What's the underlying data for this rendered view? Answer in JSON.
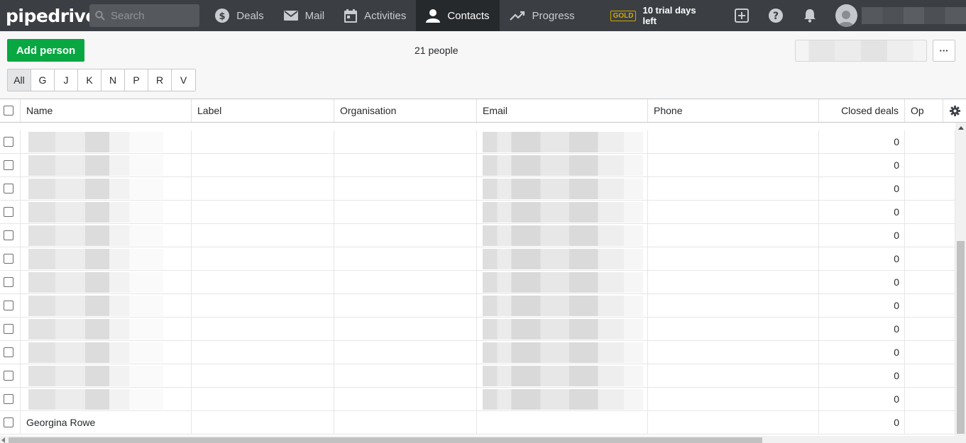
{
  "nav": {
    "logo": "pipedrive",
    "search_placeholder": "Search",
    "items": [
      {
        "label": "Deals",
        "icon": "dollar-circle-icon",
        "active": false
      },
      {
        "label": "Mail",
        "icon": "envelope-icon",
        "active": false
      },
      {
        "label": "Activities",
        "icon": "calendar-icon",
        "active": false
      },
      {
        "label": "Contacts",
        "icon": "person-icon",
        "active": true
      },
      {
        "label": "Progress",
        "icon": "trend-up-icon",
        "active": false
      }
    ],
    "plan_badge": "GOLD",
    "trial_text": "10 trial days left"
  },
  "toolbar": {
    "add_person_label": "Add person",
    "people_count": "21 people",
    "more_label": "···"
  },
  "alphabet": [
    "All",
    "G",
    "J",
    "K",
    "N",
    "P",
    "R",
    "V"
  ],
  "table": {
    "columns": [
      "Name",
      "Label",
      "Organisation",
      "Email",
      "Phone",
      "Closed deals",
      "Op"
    ],
    "rows": [
      {
        "name": "",
        "closed_deals": "0"
      },
      {
        "name": "",
        "closed_deals": "0"
      },
      {
        "name": "",
        "closed_deals": "0"
      },
      {
        "name": "",
        "closed_deals": "0"
      },
      {
        "name": "",
        "closed_deals": "0"
      },
      {
        "name": "",
        "closed_deals": "0"
      },
      {
        "name": "",
        "closed_deals": "0"
      },
      {
        "name": "",
        "closed_deals": "0"
      },
      {
        "name": "",
        "closed_deals": "0"
      },
      {
        "name": "",
        "closed_deals": "0"
      },
      {
        "name": "",
        "closed_deals": "0"
      },
      {
        "name": "",
        "closed_deals": "0"
      },
      {
        "name": "Georgina Rowe",
        "closed_deals": "0"
      }
    ]
  },
  "colors": {
    "topbar": "#3b3f44",
    "active_nav": "#26292c",
    "primary_button": "#08a742",
    "gold": "#d1a800"
  }
}
